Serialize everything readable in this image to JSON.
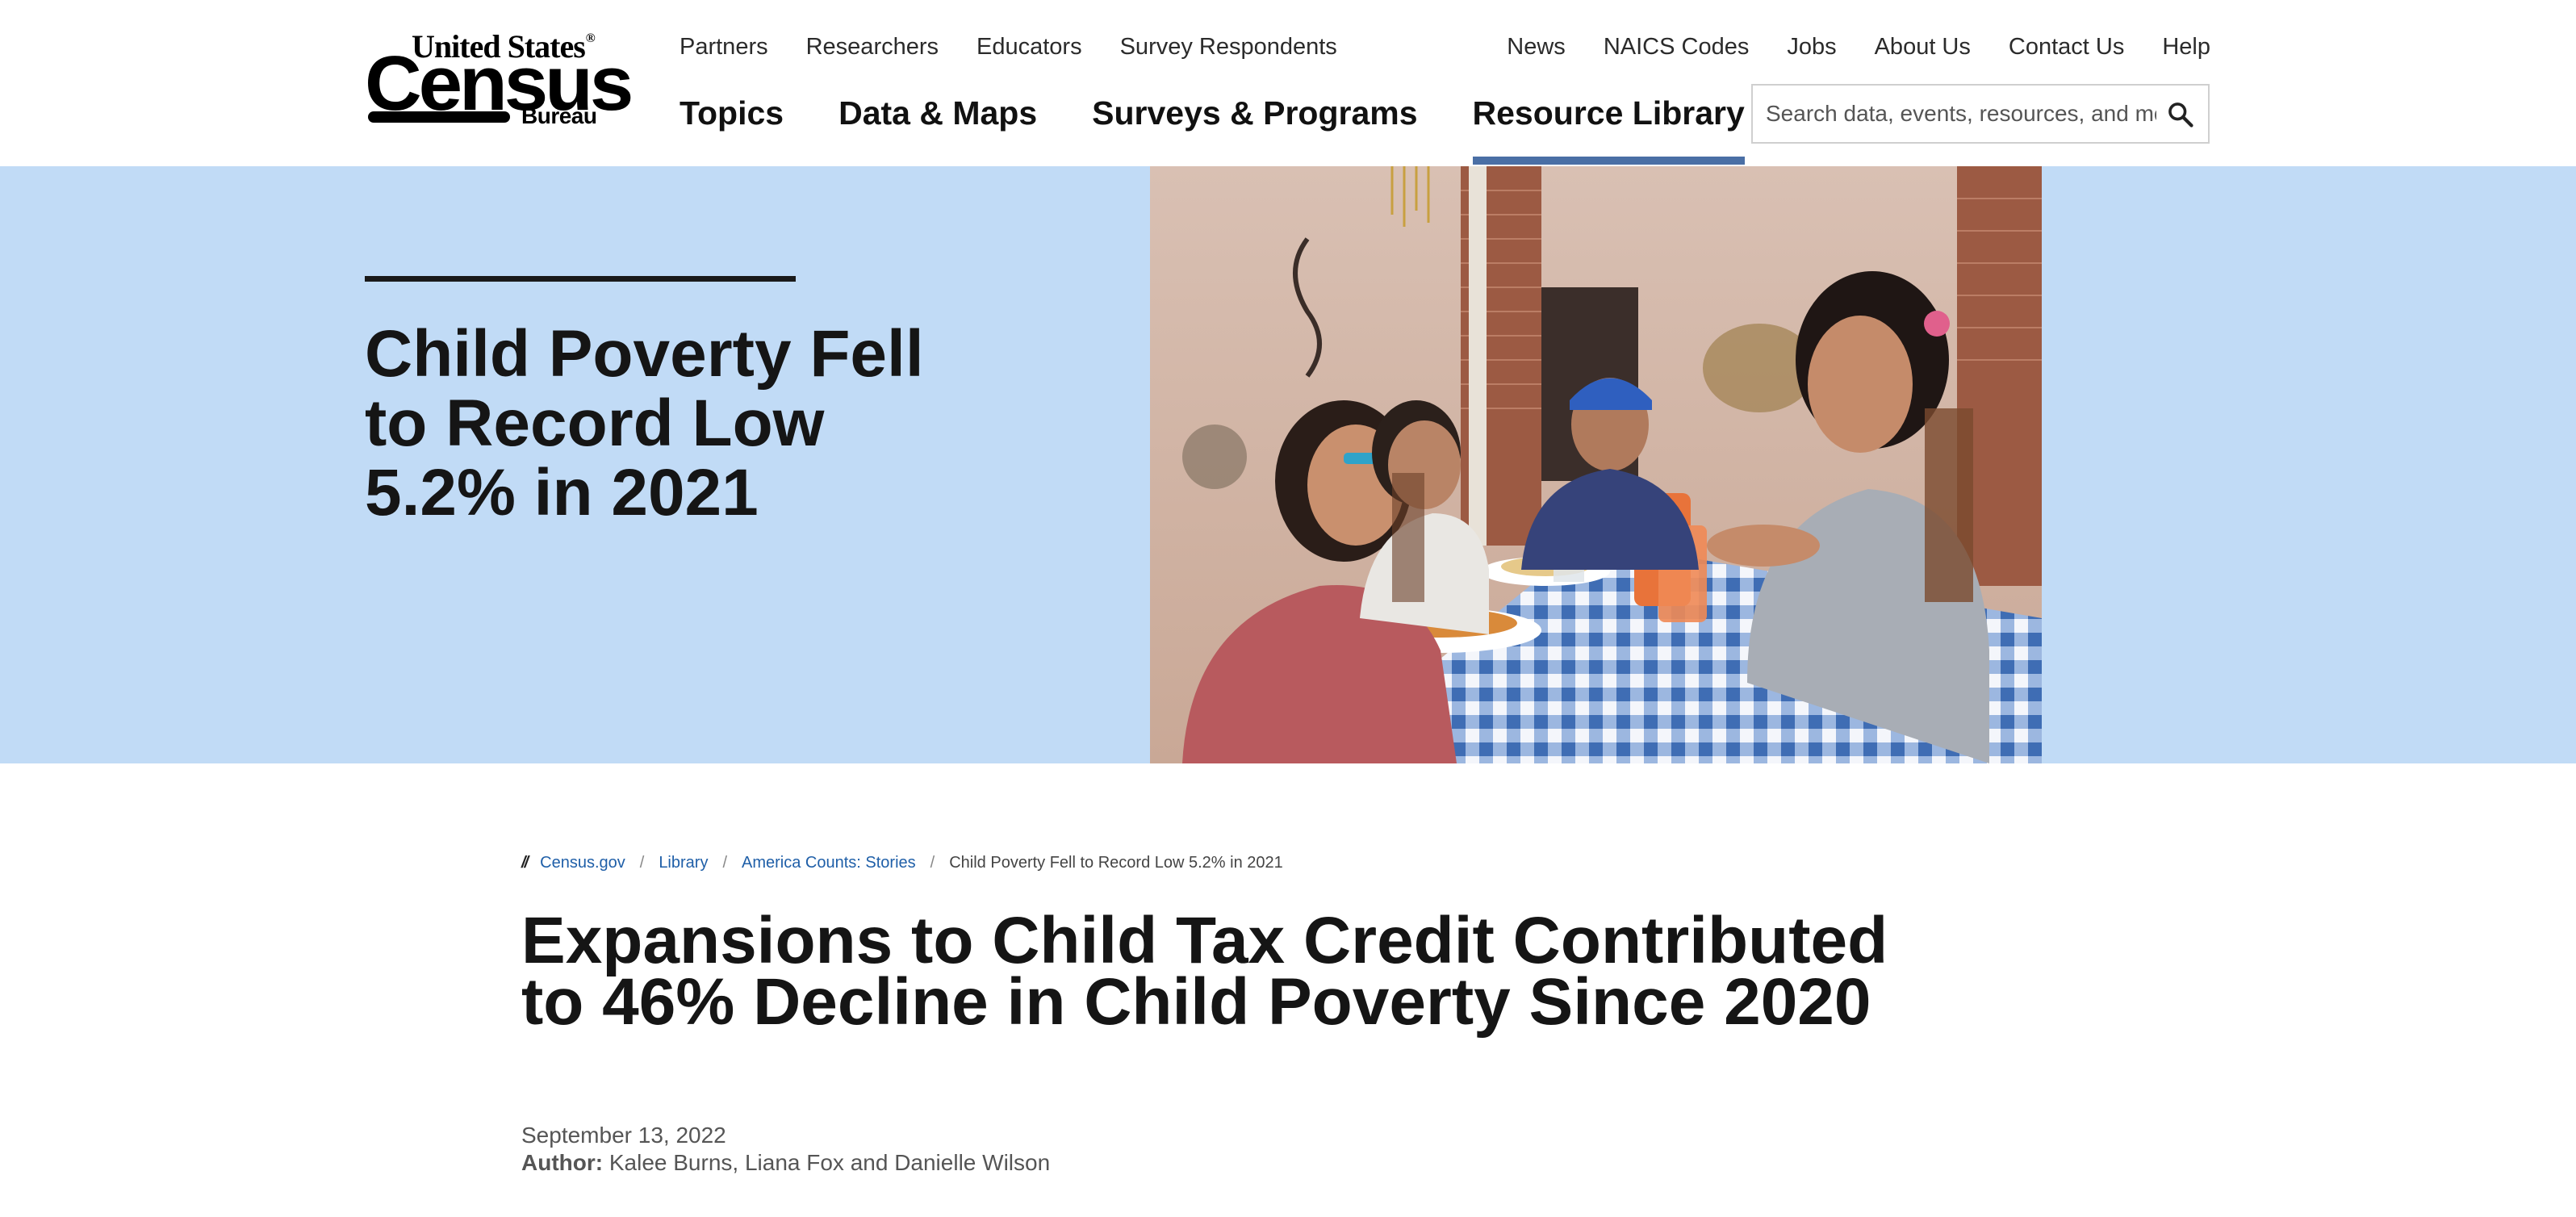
{
  "logo": {
    "top_text": "United States",
    "registered_mark": "®",
    "main_text": "Census",
    "bottom_text": "Bureau"
  },
  "utility_nav_left": [
    "Partners",
    "Researchers",
    "Educators",
    "Survey Respondents"
  ],
  "utility_nav_right": [
    "News",
    "NAICS Codes",
    "Jobs",
    "About Us",
    "Contact Us",
    "Help"
  ],
  "main_nav": {
    "items": [
      "Topics",
      "Data & Maps",
      "Surveys & Programs",
      "Resource Library"
    ],
    "active": "Resource Library",
    "active_color": "#4a6fa5"
  },
  "search": {
    "placeholder": "Search data, events, resources, and more",
    "icon": "search-icon"
  },
  "hero": {
    "background": "#c1dbf6",
    "title": "Child Poverty Fell to Record Low 5.2% in 2021",
    "photo_subject": "family-eating-at-table-photo"
  },
  "breadcrumb": {
    "items": [
      "Census.gov",
      "Library",
      "America Counts: Stories"
    ],
    "current": "Child Poverty Fell to Record Low 5.2% in 2021",
    "link_color": "#1f5fa8"
  },
  "article": {
    "headline": "Expansions to Child Tax Credit Contributed to 46% Decline in Child Poverty Since 2020",
    "date": "September 13, 2022",
    "author_label": "Author:",
    "authors": "Kalee Burns, Liana Fox and Danielle Wilson"
  }
}
